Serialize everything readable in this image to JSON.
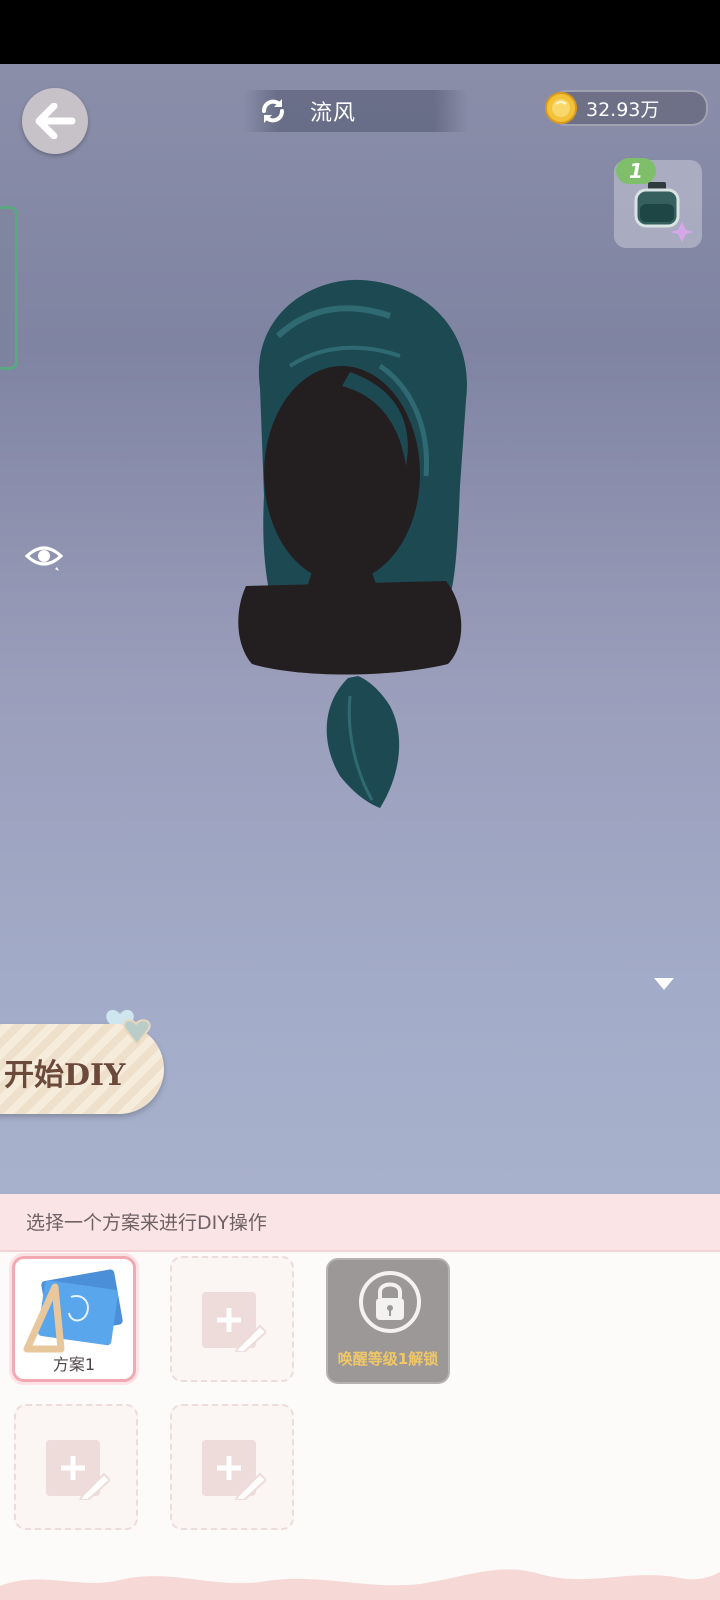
{
  "header": {
    "back_icon": "arrow-left-icon",
    "refresh_icon": "refresh-icon",
    "style_name": "流风",
    "coin_icon": "gold-coin-icon",
    "coin_amount": "32.93万",
    "item_badge": "1",
    "item_icon": "dye-bottle-icon"
  },
  "scene": {
    "eye_icon": "eye-icon",
    "expand_icon": "chevron-down-icon",
    "start_diy_label": "开始DIY"
  },
  "panel": {
    "hint": "选择一个方案来进行DIY操作",
    "slots": [
      {
        "state": "active",
        "label": "方案1"
      },
      {
        "state": "empty"
      },
      {
        "state": "locked",
        "label": "唤醒等级1解锁"
      },
      {
        "state": "empty"
      },
      {
        "state": "empty"
      }
    ]
  },
  "colors": {
    "accent_pink": "#f2a9b2",
    "locked_text": "#f0c766",
    "hair": "#1d4a52",
    "badge_green": "#7fbf6b"
  }
}
